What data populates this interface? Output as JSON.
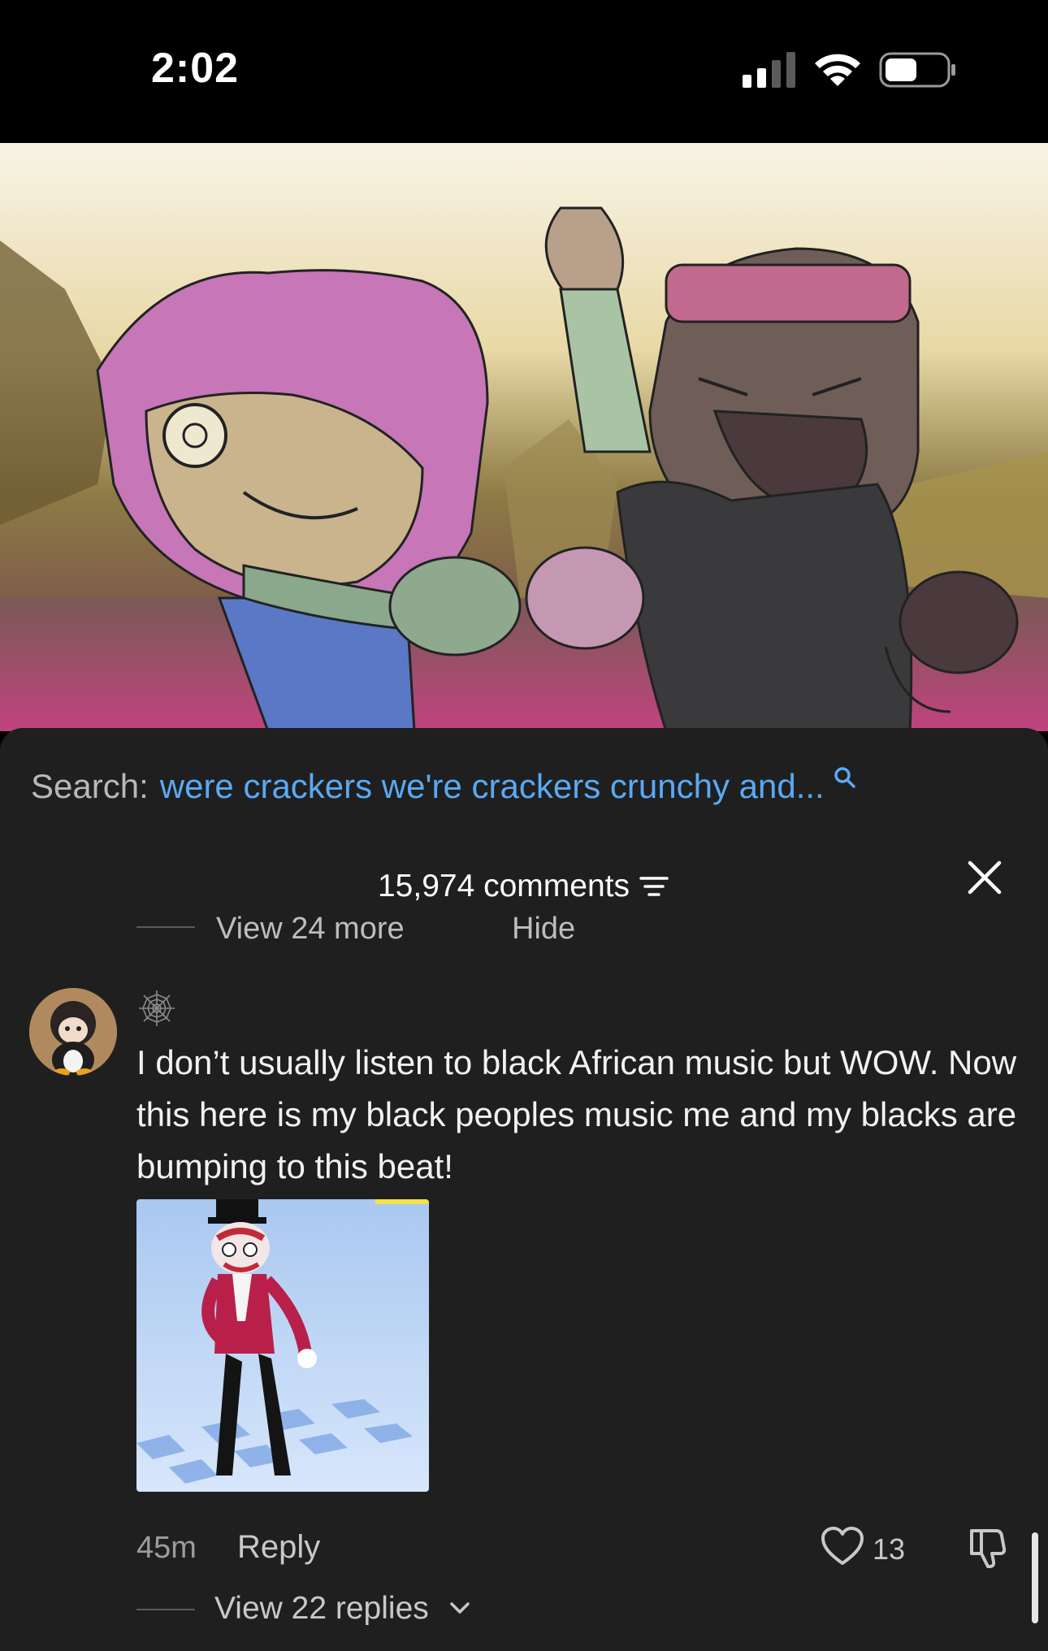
{
  "status_bar": {
    "time": "2:02"
  },
  "search": {
    "label": "Search:",
    "query": "were crackers we're crackers crunchy and..."
  },
  "comments_header": {
    "count_label": "15,974 comments"
  },
  "previous_thread": {
    "view_more_label": "View 24 more",
    "hide_label": "Hide"
  },
  "comment": {
    "text": "I don’t usually listen to black African music but WOW. Now this here is my black peoples music me and my blacks are bumping to this beat!",
    "timestamp": "45m",
    "reply_label": "Reply",
    "like_count": "13",
    "view_replies_label": "View 22 replies"
  },
  "colors": {
    "sheet_background": "#1f1f20",
    "link_blue": "#5aa9f3",
    "muted_text": "#9c9ca0"
  }
}
